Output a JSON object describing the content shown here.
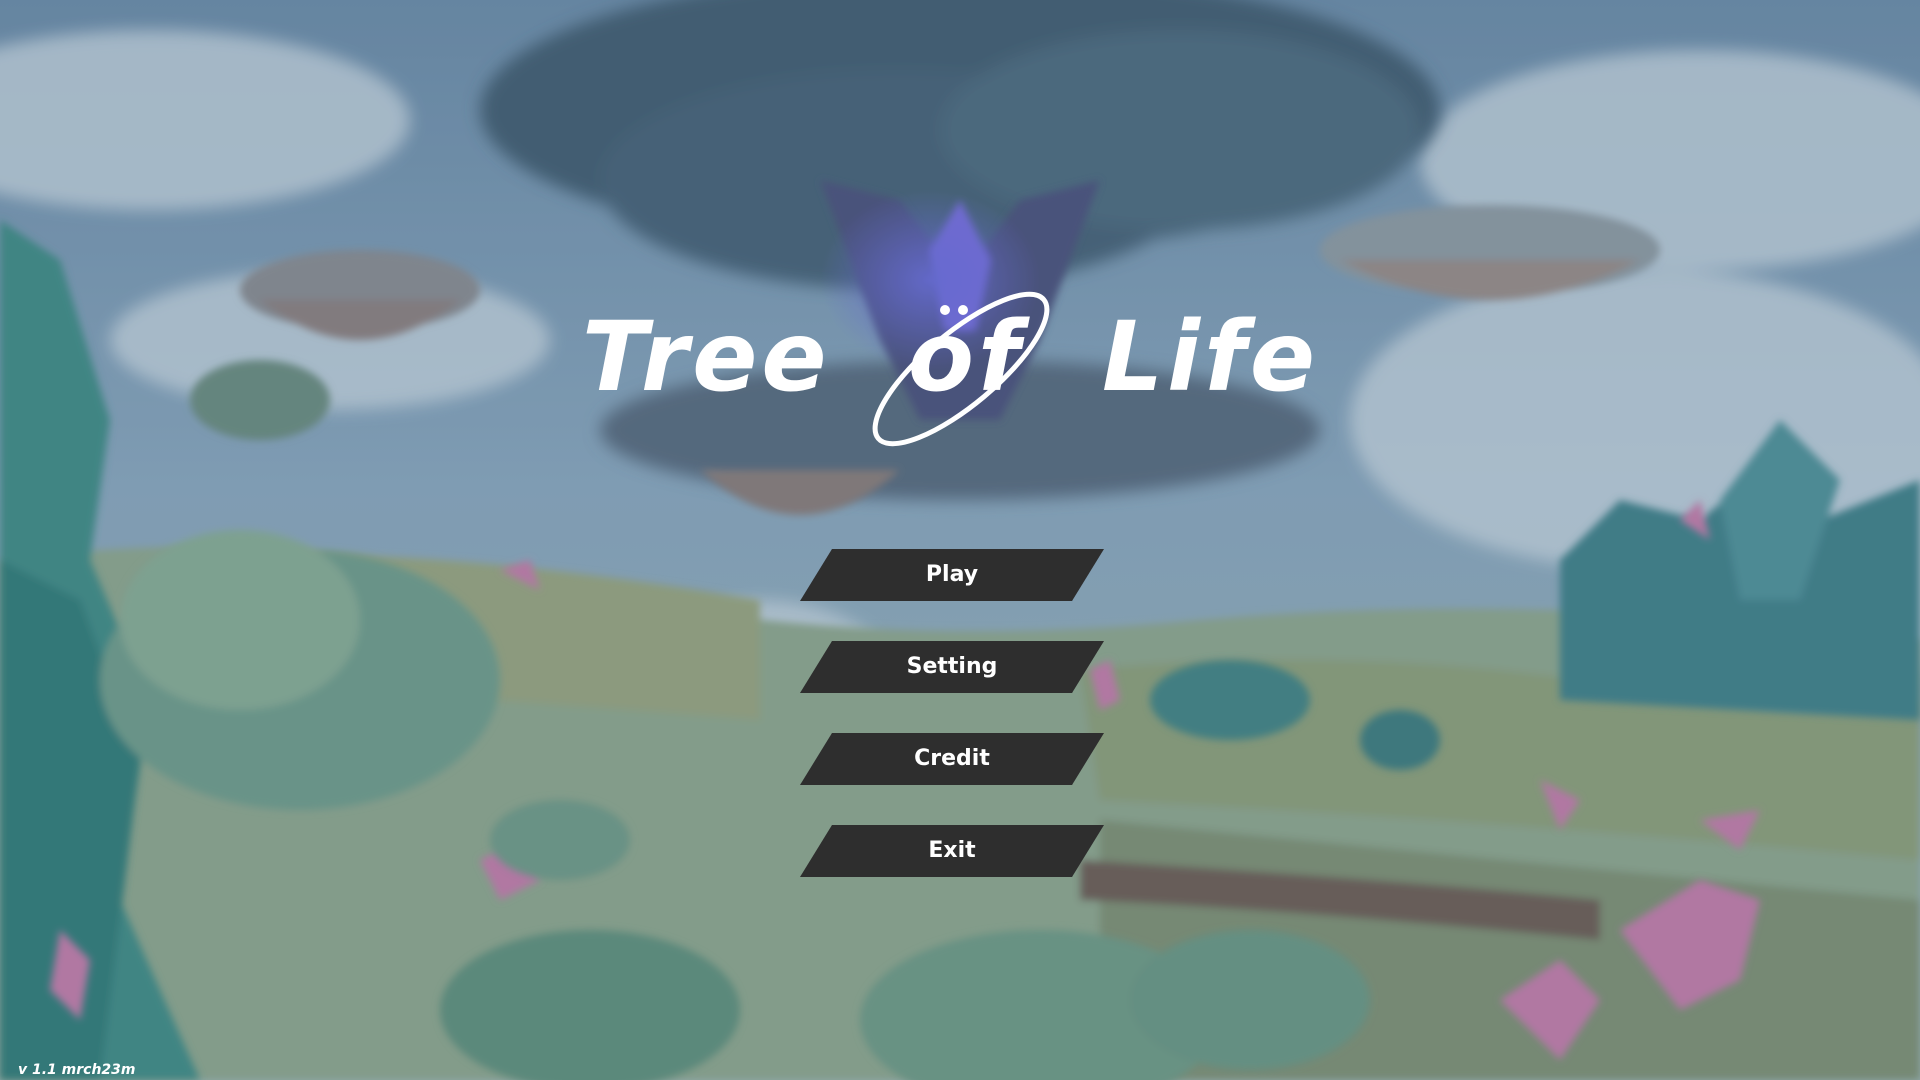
{
  "game": {
    "title": "Tree of Life",
    "title_part1": "Tree",
    "title_part2": "of",
    "title_part3": "Life"
  },
  "menu": {
    "items": [
      {
        "label": "Play"
      },
      {
        "label": "Setting"
      },
      {
        "label": "Credit"
      },
      {
        "label": "Exit"
      }
    ]
  },
  "footer": {
    "version": "v 1.1 mrch23m"
  },
  "colors": {
    "button_bg": "#2e2e2e",
    "button_text": "#ffffff",
    "title": "#ffffff"
  },
  "icons": {
    "logo_ring": "orbit-ring-icon"
  }
}
